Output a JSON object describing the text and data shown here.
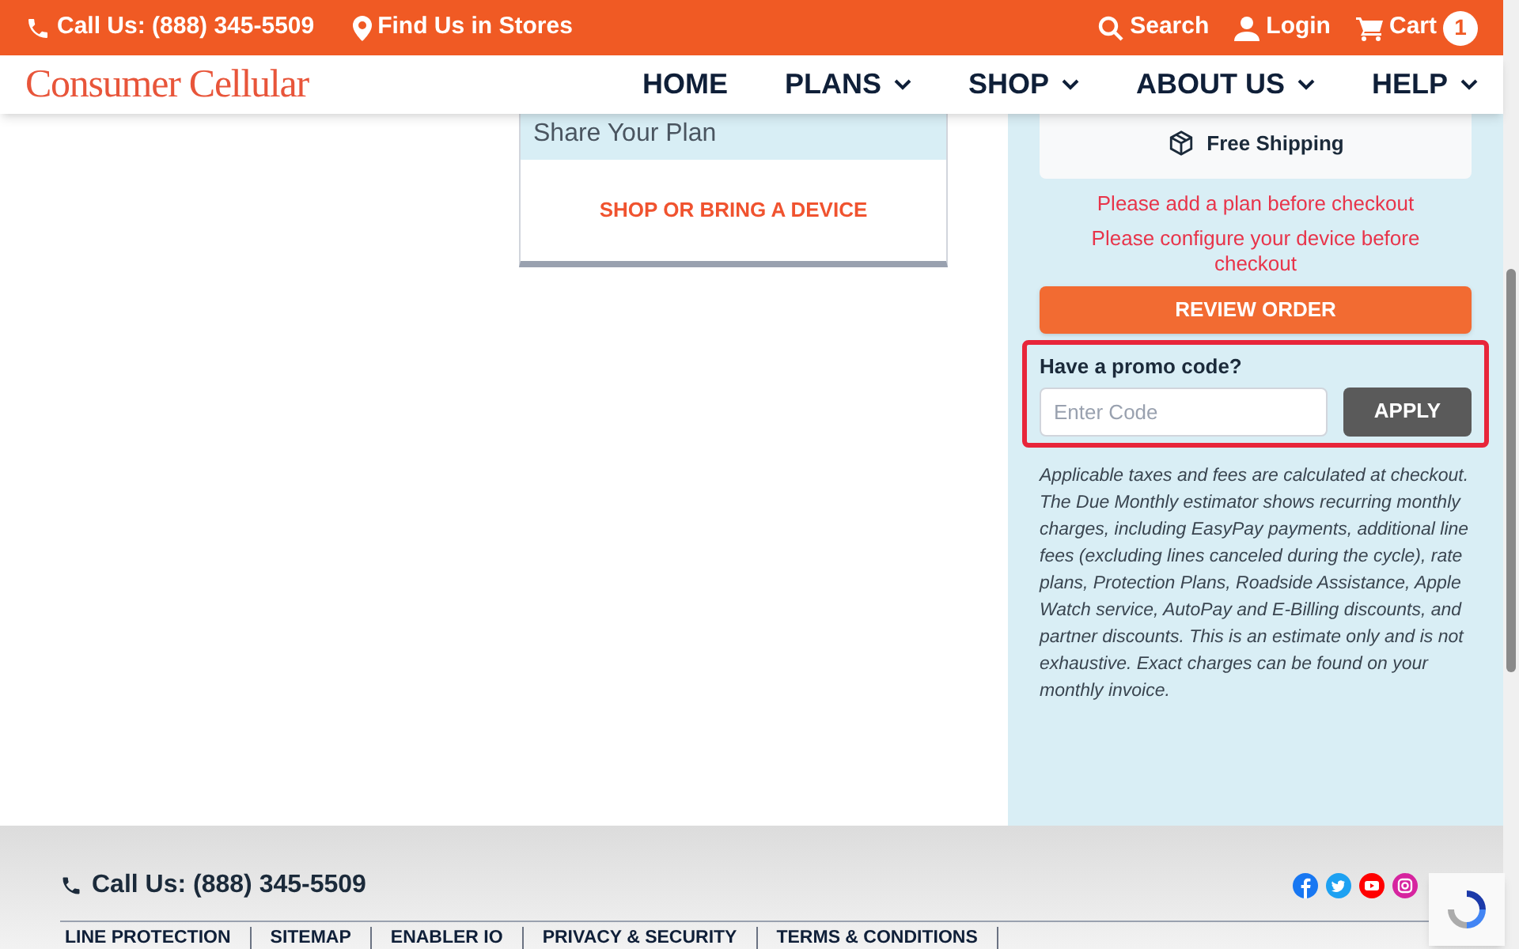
{
  "top_bar": {
    "phone": "Call Us: (888) 345-5509",
    "stores": "Find Us in Stores",
    "search": "Search",
    "login": "Login",
    "cart": "Cart",
    "cart_count": "1"
  },
  "nav": {
    "logo": "Consumer Cellular",
    "items": [
      {
        "label": "HOME",
        "dropdown": false
      },
      {
        "label": "PLANS",
        "dropdown": true
      },
      {
        "label": "SHOP",
        "dropdown": true
      },
      {
        "label": "ABOUT US",
        "dropdown": true
      },
      {
        "label": "HELP",
        "dropdown": true
      }
    ]
  },
  "plan_card": {
    "title": "Share Your Plan",
    "link": "SHOP OR BRING A DEVICE"
  },
  "summary": {
    "shipping": "Free Shipping",
    "errors": [
      "Please add a plan before checkout",
      "Please configure your device before checkout"
    ],
    "review_button": "REVIEW ORDER",
    "promo": {
      "label": "Have a promo code?",
      "placeholder": "Enter Code",
      "button": "APPLY"
    },
    "notes": [
      "Applicable taxes and fees are calculated at checkout.",
      "The Due Monthly estimator shows recurring monthly charges, including EasyPay payments, additional line fees (excluding lines canceled during the cycle), rate plans, Protection Plans, Roadside Assistance, Apple Watch service, AutoPay and E-Billing discounts, and partner discounts. This is an estimate only and is not exhaustive. Exact charges can be found on your monthly invoice."
    ]
  },
  "footer": {
    "phone": "Call Us: (888) 345-5509",
    "links": [
      "LINE PROTECTION",
      "SITEMAP",
      "ENABLER IO",
      "PRIVACY & SECURITY",
      "TERMS & CONDITIONS"
    ]
  }
}
